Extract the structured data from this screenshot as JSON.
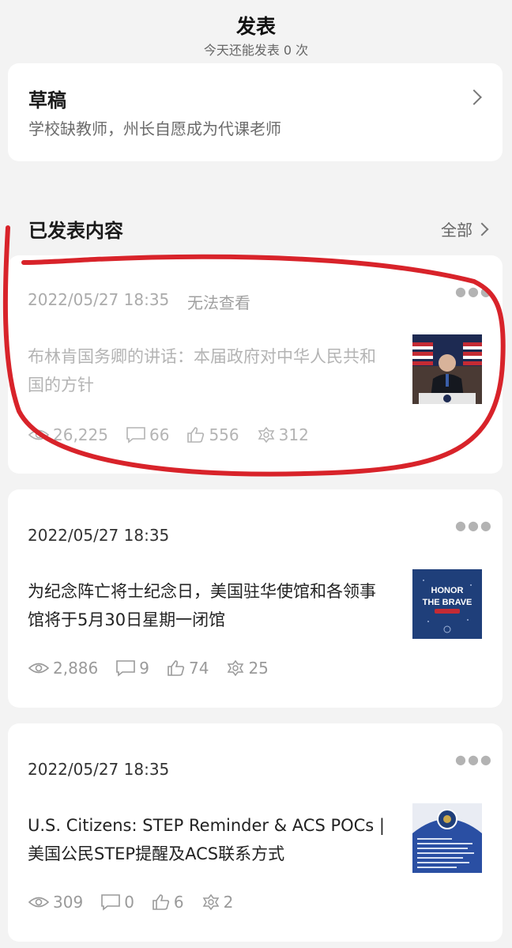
{
  "header": {
    "title": "发表",
    "subtitle": "今天还能发表 0 次"
  },
  "draft": {
    "title": "草稿",
    "text": "学校缺教师，州长自愿成为代课老师",
    "chevron_icon": "chevron-right-icon"
  },
  "published": {
    "title": "已发表内容",
    "all_label": "全部"
  },
  "posts": [
    {
      "date": "2022/05/27 18:35",
      "status": "无法查看",
      "title": "布林肯国务卿的讲话：本届政府对中华人民共和国的方针",
      "views": "26,225",
      "comments": "66",
      "likes": "556",
      "shares": "312",
      "thumb": "speaker-at-podium-image"
    },
    {
      "date": "2022/05/27 18:35",
      "status": "",
      "title": "为纪念阵亡将士纪念日，美国驻华使馆和各领事馆将于5月30日星期一闭馆",
      "views": "2,886",
      "comments": "9",
      "likes": "74",
      "shares": "25",
      "thumb": "honor-the-brave-image",
      "thumb_text": [
        "HONOR",
        "THE BRAVE"
      ]
    },
    {
      "date": "2022/05/27 18:35",
      "status": "",
      "title": "U.S. Citizens: STEP Reminder & ACS POCs | 美国公民STEP提醒及ACS联系方式",
      "views": "309",
      "comments": "0",
      "likes": "6",
      "shares": "2",
      "thumb": "embassy-seal-image"
    }
  ],
  "colors": {
    "background": "#f3f3f3",
    "card": "#ffffff",
    "annotation_red": "#d8232a"
  },
  "more_icon": "more-dots-icon"
}
